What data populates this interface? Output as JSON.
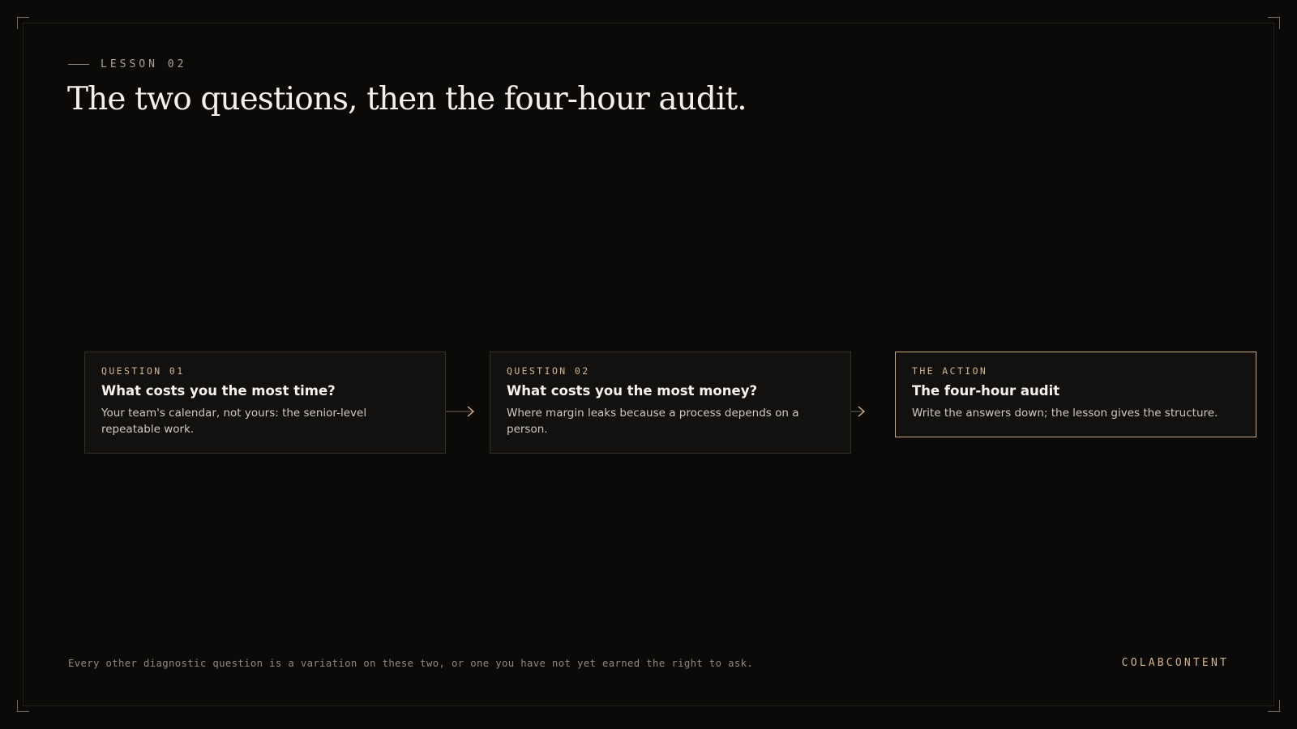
{
  "colors": {
    "background": "#0b0a09",
    "accent": "#d3b58f",
    "text_primary": "#f5f1ea",
    "text_muted": "#8e8980"
  },
  "header": {
    "eyebrow": "LESSON 02",
    "title": "The two questions, then the four-hour audit."
  },
  "steps": [
    {
      "eyebrow": "QUESTION 01",
      "title": "What costs you the most time?",
      "description": "Your team's calendar, not yours: the senior-level repeatable work."
    },
    {
      "eyebrow": "QUESTION 02",
      "title": "What costs you the most money?",
      "description": "Where margin leaks because a process depends on a person."
    },
    {
      "eyebrow": "THE ACTION",
      "title": "The four-hour audit",
      "description": "Write the answers down; the lesson gives the structure."
    }
  ],
  "connectors": [
    {
      "icon": "arrow-right-icon"
    },
    {
      "icon": "arrow-right-icon"
    }
  ],
  "footer": {
    "note": "Every other diagnostic question is a variation on these two, or one you have not yet earned the right to ask.",
    "brand": "COLABCONTENT"
  }
}
